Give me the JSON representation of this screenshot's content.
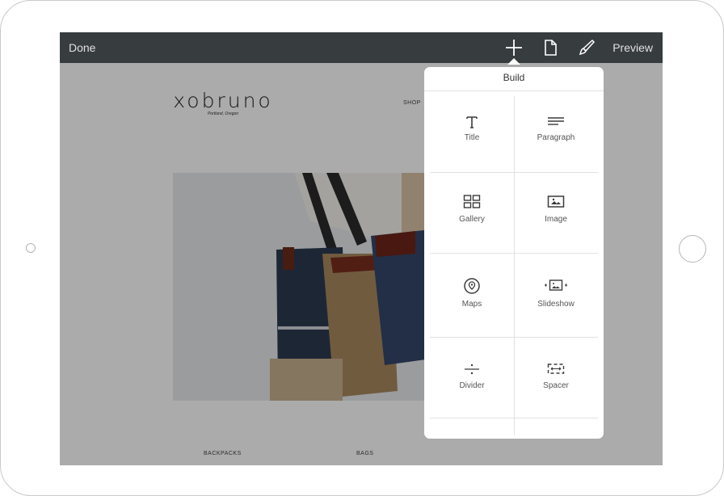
{
  "toolbar": {
    "done_label": "Done",
    "preview_label": "Preview",
    "icons": [
      "add-icon",
      "page-icon",
      "brush-icon"
    ]
  },
  "site": {
    "logo": "xobruno",
    "logo_subtitle": "Portland, Oregon",
    "nav_shop": "SHOP",
    "categories": [
      "BACKPACKS",
      "BAGS"
    ]
  },
  "build_panel": {
    "title": "Build",
    "blocks": [
      {
        "label": "Title",
        "icon": "title-icon"
      },
      {
        "label": "Paragraph",
        "icon": "paragraph-icon"
      },
      {
        "label": "Gallery",
        "icon": "gallery-icon"
      },
      {
        "label": "Image",
        "icon": "image-icon"
      },
      {
        "label": "Maps",
        "icon": "map-pin-icon"
      },
      {
        "label": "Slideshow",
        "icon": "slideshow-icon"
      },
      {
        "label": "Divider",
        "icon": "divider-icon"
      },
      {
        "label": "Spacer",
        "icon": "spacer-icon"
      }
    ]
  },
  "colors": {
    "toolbar_bg": "#373c3f",
    "overlay": "rgba(0,0,0,0.33)",
    "panel_bg": "#ffffff"
  }
}
